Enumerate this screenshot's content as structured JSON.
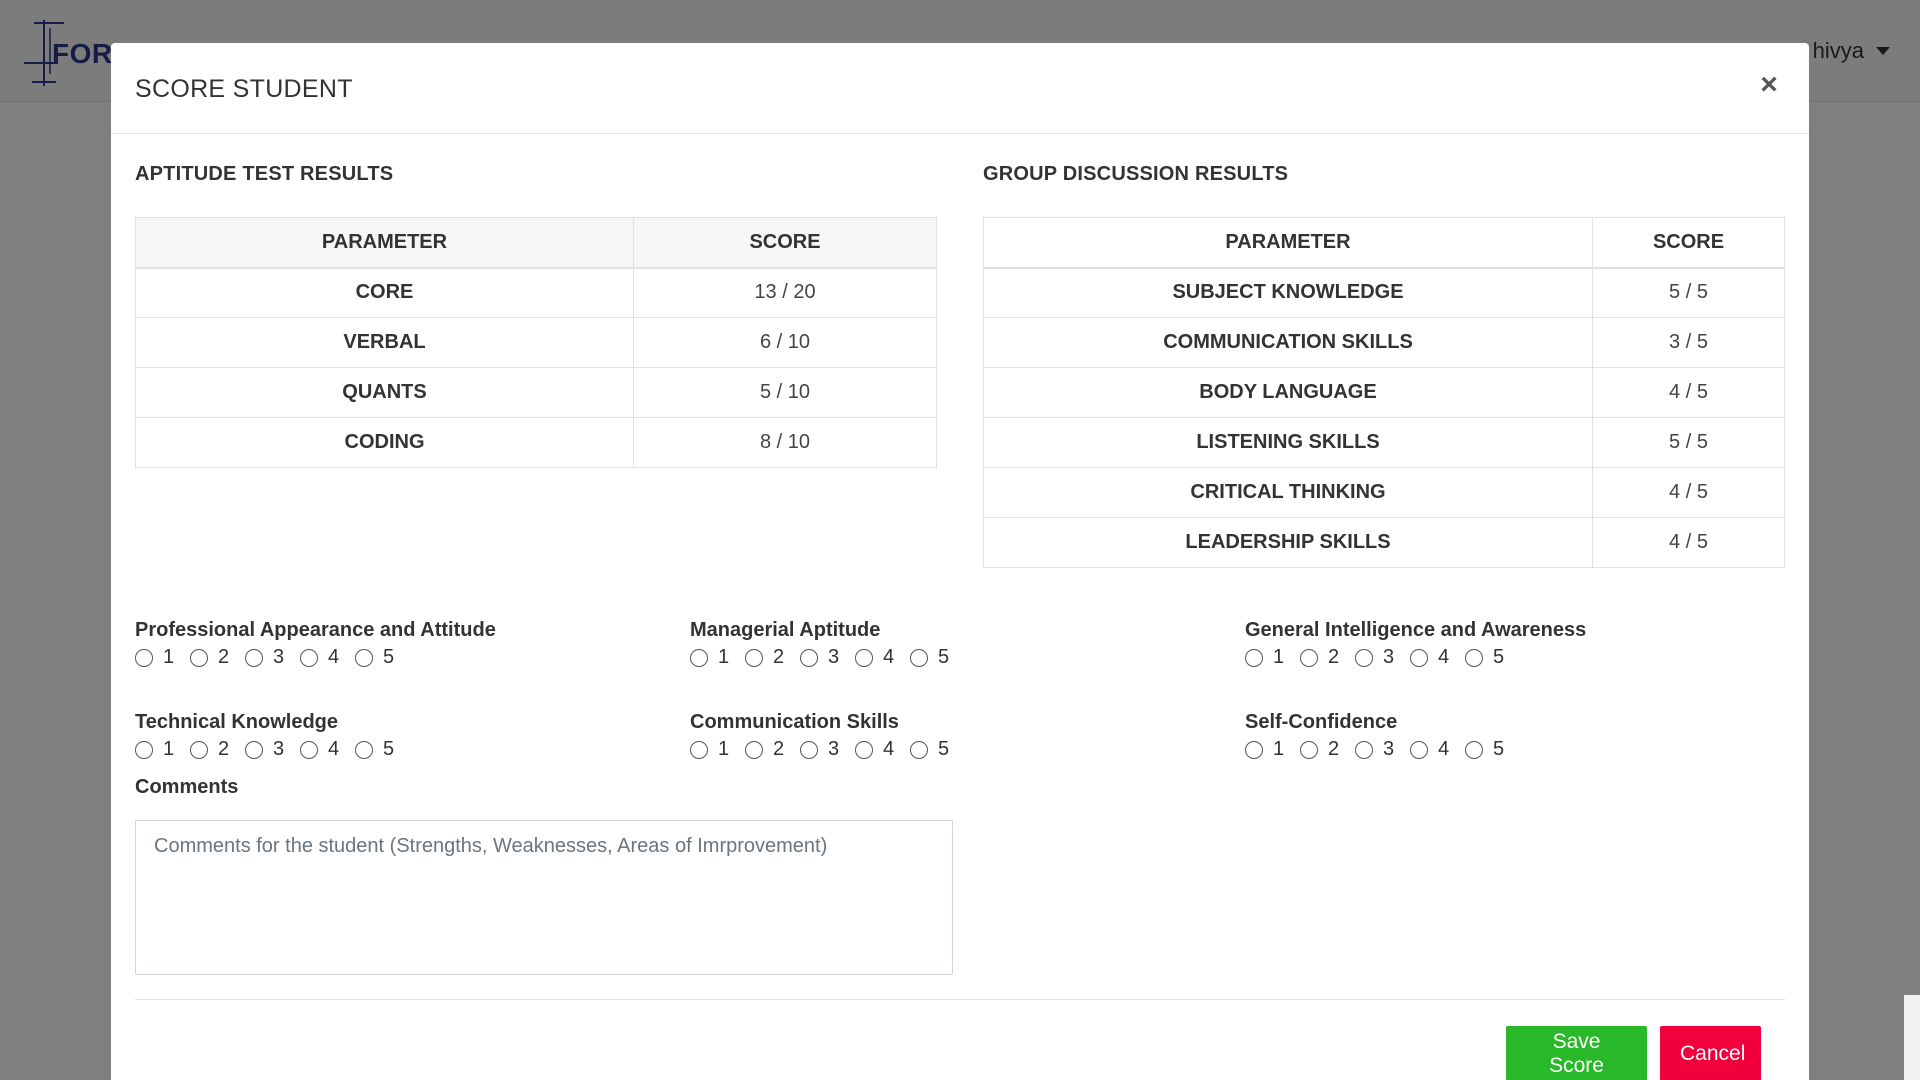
{
  "colors": {
    "save_button": "#29b829",
    "cancel_button": "#f2003c",
    "overlay": "rgba(0,0,0,0.5)",
    "logo": "#2b3b8f"
  },
  "navbar": {
    "logo_text": "FORE",
    "user_name": "hivya"
  },
  "modal": {
    "title": "SCORE STUDENT",
    "close_label": "×",
    "aptitude": {
      "heading": "APTITUDE TEST RESULTS",
      "columns": [
        "PARAMETER",
        "SCORE"
      ],
      "rows": [
        {
          "parameter": "CORE",
          "score": "13 / 20"
        },
        {
          "parameter": "VERBAL",
          "score": "6 / 10"
        },
        {
          "parameter": "QUANTS",
          "score": "5 / 10"
        },
        {
          "parameter": "CODING",
          "score": "8 / 10"
        }
      ]
    },
    "group_discussion": {
      "heading": "GROUP DISCUSSION RESULTS",
      "columns": [
        "PARAMETER",
        "SCORE"
      ],
      "rows": [
        {
          "parameter": "SUBJECT KNOWLEDGE",
          "score": "5 / 5"
        },
        {
          "parameter": "COMMUNICATION SKILLS",
          "score": "3 / 5"
        },
        {
          "parameter": "BODY LANGUAGE",
          "score": "4 / 5"
        },
        {
          "parameter": "LISTENING SKILLS",
          "score": "5 / 5"
        },
        {
          "parameter": "CRITICAL THINKING",
          "score": "4 / 5"
        },
        {
          "parameter": "LEADERSHIP SKILLS",
          "score": "4 / 5"
        }
      ]
    },
    "ratings": [
      {
        "label": "Professional Appearance and Attitude",
        "options": [
          "1",
          "2",
          "3",
          "4",
          "5"
        ]
      },
      {
        "label": "Managerial Aptitude",
        "options": [
          "1",
          "2",
          "3",
          "4",
          "5"
        ]
      },
      {
        "label": "General Intelligence and Awareness",
        "options": [
          "1",
          "2",
          "3",
          "4",
          "5"
        ]
      },
      {
        "label": "Technical Knowledge",
        "options": [
          "1",
          "2",
          "3",
          "4",
          "5"
        ]
      },
      {
        "label": "Communication Skills",
        "options": [
          "1",
          "2",
          "3",
          "4",
          "5"
        ]
      },
      {
        "label": "Self-Confidence",
        "options": [
          "1",
          "2",
          "3",
          "4",
          "5"
        ]
      }
    ],
    "comments": {
      "label": "Comments",
      "placeholder": "Comments for the student (Strengths, Weaknesses, Areas of Imrprovement)",
      "value": ""
    },
    "buttons": {
      "save": "Save Score",
      "cancel": "Cancel"
    }
  }
}
